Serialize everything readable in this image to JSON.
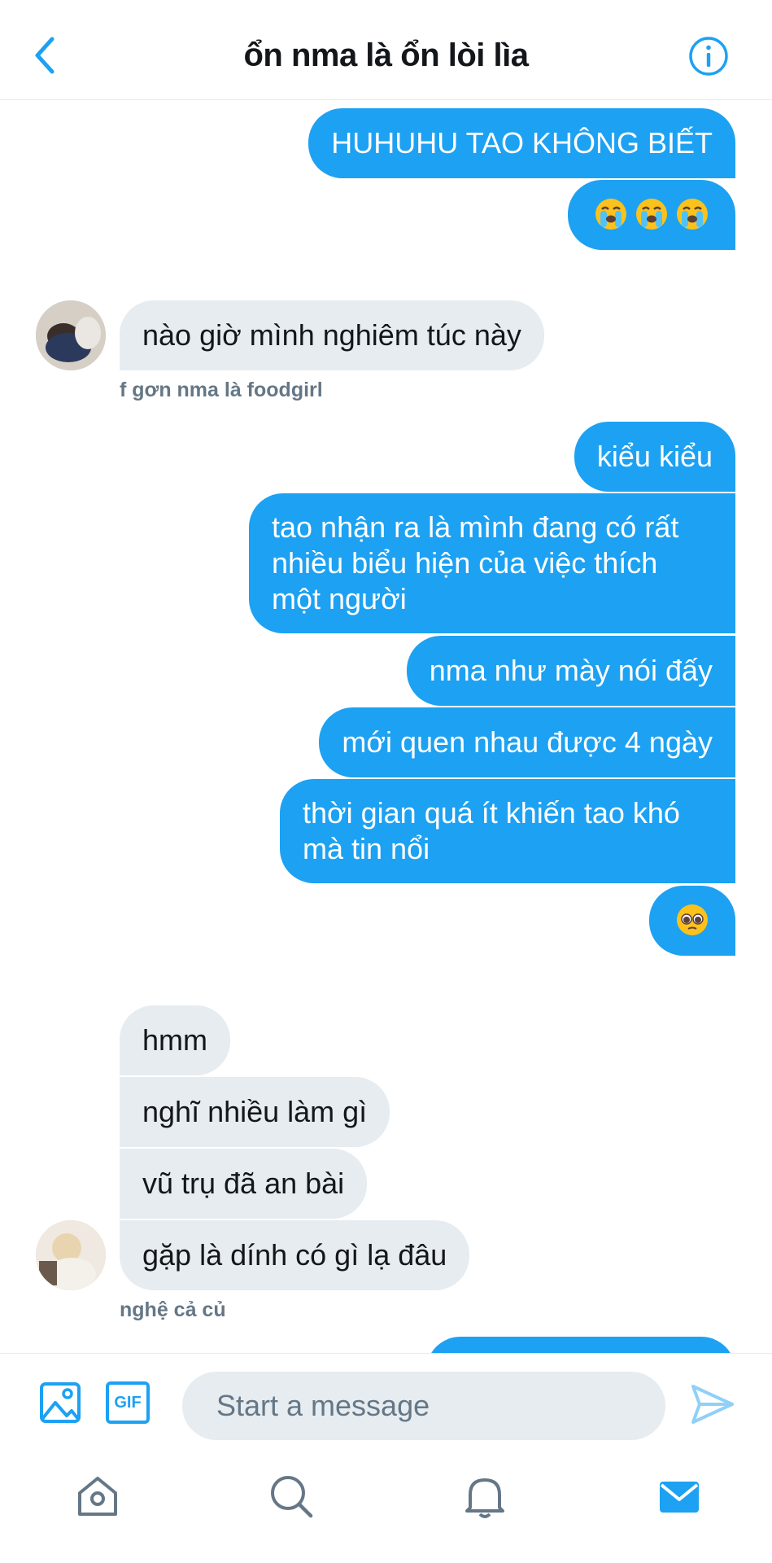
{
  "header": {
    "title": "ổn nma là ổn lòi lìa"
  },
  "messages": [
    {
      "direction": "out",
      "text": "HUHUHU TAO KHÔNG BIẾT"
    },
    {
      "direction": "out",
      "emojis": [
        "loudly-crying-face",
        "loudly-crying-face",
        "loudly-crying-face"
      ]
    },
    {
      "direction": "in",
      "text": "nào giờ mình nghiêm túc này",
      "sender_caption": "f gơn nma là foodgirl"
    },
    {
      "direction": "out",
      "text": "kiểu kiểu"
    },
    {
      "direction": "out",
      "text": "tao nhận ra là mình đang có rất nhiều biểu hiện của việc thích một người"
    },
    {
      "direction": "out",
      "text": "nma như mày nói đấy"
    },
    {
      "direction": "out",
      "text": "mới quen nhau được 4 ngày"
    },
    {
      "direction": "out",
      "text": "thời gian quá ít khiến tao khó mà tin nổi"
    },
    {
      "direction": "out",
      "emojis": [
        "pleading-face"
      ]
    },
    {
      "direction": "in",
      "text": "hmm"
    },
    {
      "direction": "in",
      "text": "nghĩ nhiều làm gì"
    },
    {
      "direction": "in",
      "text": "vũ trụ đã an bài"
    },
    {
      "direction": "in",
      "text": "gặp là dính có gì lạ đâu",
      "sender_caption": "nghệ cả củ"
    }
  ],
  "composer": {
    "placeholder": "Start a message",
    "gif_label": "GIF"
  },
  "icons": {
    "back": "chevron-left-icon",
    "info": "info-icon",
    "media": "image-icon",
    "send": "send-icon",
    "home": "home-icon",
    "search": "search-icon",
    "notifications": "bell-icon",
    "messages": "mail-icon"
  },
  "colors": {
    "accent": "#1da1f2",
    "incoming_bubble": "#e6ecf0",
    "caption": "#657786"
  }
}
